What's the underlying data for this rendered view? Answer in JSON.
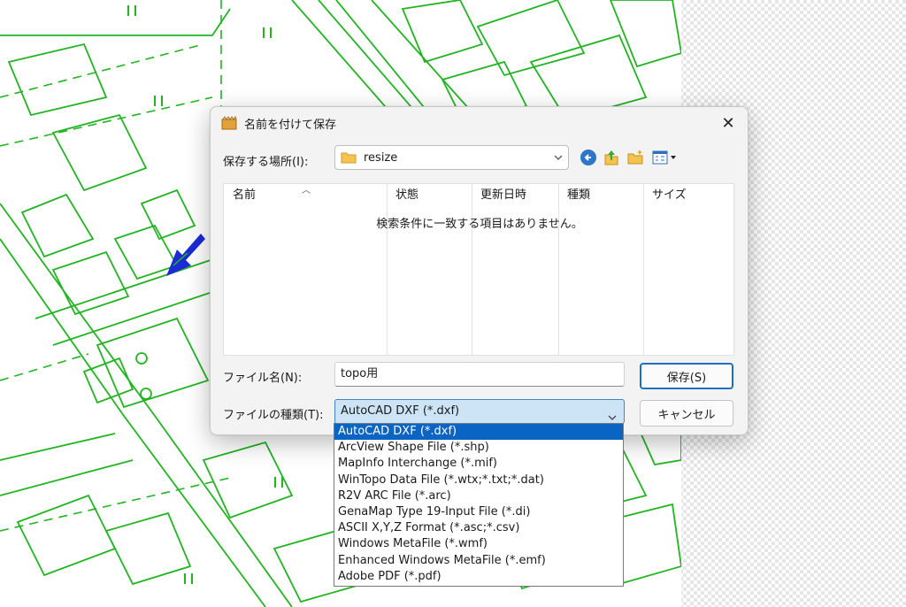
{
  "dialog": {
    "title": "名前を付けて保存",
    "close_glyph": "✕",
    "location_label": "保存する場所(I):",
    "location_value": "resize",
    "columns": [
      "名前",
      "状態",
      "更新日時",
      "種類",
      "サイズ"
    ],
    "empty_message": "検索条件に一致する項目はありません。",
    "filename_label": "ファイル名(N):",
    "filename_value": "topo用",
    "filetype_label": "ファイルの種類(T):",
    "filetype_value": "AutoCAD DXF (*.dxf)",
    "save_label": "保存(S)",
    "cancel_label": "キャンセル"
  },
  "toolbar_icons": [
    "back-icon",
    "up-folder-icon",
    "new-folder-icon",
    "view-menu-icon"
  ],
  "filetype_options": [
    "AutoCAD DXF (*.dxf)",
    "ArcView Shape File (*.shp)",
    "MapInfo Interchange (*.mif)",
    "WinTopo Data File (*.wtx;*.txt;*.dat)",
    "R2V ARC File (*.arc)",
    "GenaMap Type 19-Input File (*.di)",
    "ASCII X,Y,Z Format (*.asc;*.csv)",
    "Windows MetaFile (*.wmf)",
    "Enhanced Windows MetaFile (*.emf)",
    "Adobe PDF (*.pdf)"
  ],
  "selected_option_index": 0,
  "colors": {
    "map_line": "#22b422",
    "arrow": "#1a2bd6",
    "selection": "#0a64c4",
    "select_bg": "#cde4f7"
  }
}
